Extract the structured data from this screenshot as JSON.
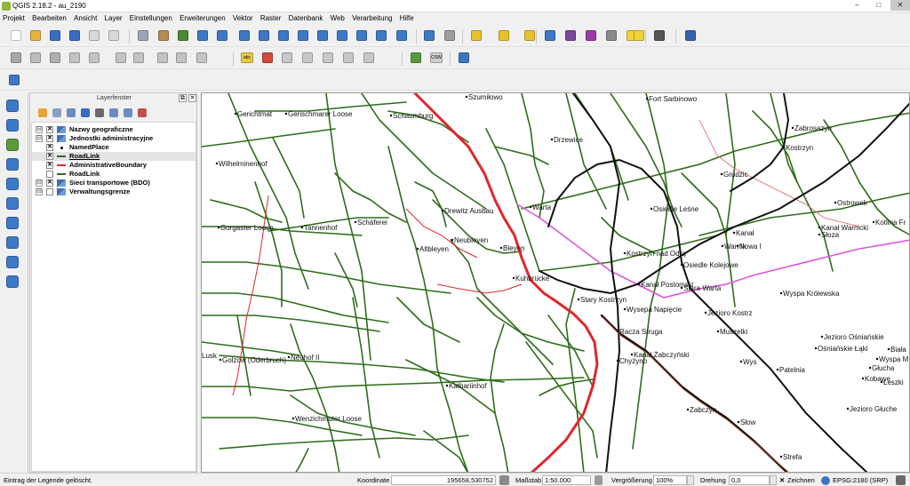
{
  "window": {
    "title": "QGIS 2.18.2 - au_2190",
    "minimize": "–",
    "maximize": "□",
    "close": "✕"
  },
  "menu": [
    "Projekt",
    "Bearbeiten",
    "Ansicht",
    "Layer",
    "Einstellungen",
    "Erweiterungen",
    "Vektor",
    "Raster",
    "Datenbank",
    "Web",
    "Verarbeitung",
    "Hilfe"
  ],
  "toolbar_buttons_row1": [
    {
      "name": "new-project-icon",
      "color": "#ffffff"
    },
    {
      "name": "open-project-icon",
      "color": "#e6b33d"
    },
    {
      "name": "save-project-icon",
      "color": "#3a6cc4"
    },
    {
      "name": "save-as-icon",
      "color": "#3a6cc4"
    },
    {
      "name": "new-print-composer-icon",
      "color": "#d8d8d8"
    },
    {
      "name": "composer-manager-icon",
      "color": "#d8d8d8"
    },
    {
      "name": "touch-zoom-icon",
      "color": "#9aa6b8"
    },
    {
      "name": "pan-icon",
      "color": "#b98a58"
    },
    {
      "name": "pan-to-selection-icon",
      "color": "#4d8a2e"
    },
    {
      "name": "zoom-in-icon",
      "color": "#3d79c7"
    },
    {
      "name": "zoom-out-icon",
      "color": "#3d79c7"
    },
    {
      "name": "zoom-native-icon",
      "color": "#3d79c7"
    },
    {
      "name": "zoom-full-icon",
      "color": "#3d79c7"
    },
    {
      "name": "zoom-selection-icon",
      "color": "#3d79c7"
    },
    {
      "name": "zoom-layer-icon",
      "color": "#3d79c7"
    },
    {
      "name": "zoom-last-icon",
      "color": "#3d79c7"
    },
    {
      "name": "zoom-next-icon",
      "color": "#3d79c7"
    },
    {
      "name": "new-bookmark-icon",
      "color": "#3d79c7"
    },
    {
      "name": "show-bookmarks-icon",
      "color": "#3d79c7"
    },
    {
      "name": "refresh-icon",
      "color": "#3d79c7"
    },
    {
      "name": "identify-icon",
      "color": "#3d79c7"
    },
    {
      "name": "action-icon",
      "color": "#9e9e9e"
    },
    {
      "name": "select-features-icon",
      "color": "#e7c22a"
    },
    {
      "name": "select-by-value-icon",
      "color": "#e7c22a"
    },
    {
      "name": "deselect-icon",
      "color": "#e7c22a"
    },
    {
      "name": "attribute-table-icon",
      "color": "#3d79c7"
    },
    {
      "name": "field-calculator-icon",
      "color": "#7a4a9c"
    },
    {
      "name": "statistics-icon",
      "color": "#9c3aa8"
    },
    {
      "name": "measure-icon",
      "color": "#8a8a8a"
    },
    {
      "name": "map-tips-icon",
      "color": "#f2d335"
    },
    {
      "name": "annotation-icon",
      "color": "#f2d335"
    },
    {
      "name": "text-annotation-icon",
      "color": "#555555"
    },
    {
      "name": "help-icon",
      "color": "#3a5fb0"
    }
  ],
  "toolbar_buttons_row2": [
    {
      "name": "current-edits-icon",
      "color": "#a9a9a9"
    },
    {
      "name": "toggle-editing-icon",
      "color": "#bdbdbd"
    },
    {
      "name": "save-edits-icon",
      "color": "#b0b0b0"
    },
    {
      "name": "add-feature-icon",
      "color": "#c4c4c4"
    },
    {
      "name": "move-feature-icon",
      "color": "#c4c4c4"
    },
    {
      "name": "node-tool-icon",
      "color": "#c4c4c4"
    },
    {
      "name": "delete-selected-icon",
      "color": "#c4c4c4"
    },
    {
      "name": "cut-features-icon",
      "color": "#c4c4c4"
    },
    {
      "name": "copy-features-icon",
      "color": "#c4c4c4"
    },
    {
      "name": "paste-features-icon",
      "color": "#c4c4c4"
    },
    {
      "name": "label-tool-icon",
      "color": "#e8c84a"
    },
    {
      "name": "layer-labeling-icon",
      "color": "#d24a3a"
    },
    {
      "name": "pin-labels-icon",
      "color": "#c8c8c8"
    },
    {
      "name": "show-labels-icon",
      "color": "#c8c8c8"
    },
    {
      "name": "move-label-icon",
      "color": "#c8c8c8"
    },
    {
      "name": "rotate-label-icon",
      "color": "#c8c8c8"
    },
    {
      "name": "change-label-icon",
      "color": "#c8c8c8"
    },
    {
      "name": "metasearch-icon",
      "color": "#5b9a3a"
    },
    {
      "name": "csw-icon",
      "color": "#cfcfcf"
    },
    {
      "name": "python-console-icon",
      "color": "#3a76c4"
    }
  ],
  "toolbar_row2_texts": {
    "abc": "abc",
    "csw": "CSW"
  },
  "toolbar_buttons_row3": [
    {
      "name": "digitize-icon",
      "color": "#3d79c7"
    }
  ],
  "left_toolbar": [
    {
      "name": "add-vector-layer-icon",
      "color": "#3d79c7"
    },
    {
      "name": "add-raster-layer-icon",
      "color": "#3d79c7"
    },
    {
      "name": "add-spatialite-layer-icon",
      "color": "#5b9a3a"
    },
    {
      "name": "add-mssql-layer-icon",
      "color": "#3d79c7"
    },
    {
      "name": "add-wms-layer-icon",
      "color": "#3d79c7"
    },
    {
      "name": "add-wcs-layer-icon",
      "color": "#3d79c7"
    },
    {
      "name": "add-wfs-layer-icon",
      "color": "#3d79c7"
    },
    {
      "name": "add-delimited-text-icon",
      "color": "#3d79c7"
    },
    {
      "name": "new-shapefile-icon",
      "color": "#3d79c7"
    },
    {
      "name": "new-memory-layer-icon",
      "color": "#3d79c7"
    }
  ],
  "layer_panel": {
    "title": "Layerfenster",
    "float_button": "⧉",
    "close_button": "✕",
    "tools": [
      {
        "name": "open-styling-icon",
        "color": "#e8a33a"
      },
      {
        "name": "add-group-icon",
        "color": "#8aa0c0"
      },
      {
        "name": "manage-visibility-icon",
        "color": "#6b8cc0"
      },
      {
        "name": "filter-legend-icon",
        "color": "#3a6cc4"
      },
      {
        "name": "filter-expression-icon",
        "color": "#6b6b6b"
      },
      {
        "name": "expand-all-icon",
        "color": "#6b8cc0"
      },
      {
        "name": "collapse-all-icon",
        "color": "#6b8cc0"
      },
      {
        "name": "remove-layer-icon",
        "color": "#c0504d"
      }
    ],
    "layers": [
      {
        "label": "Nazwy geograficzne",
        "expand": "⊟",
        "check": "✕",
        "legend": "wms",
        "indent": 0,
        "selected": false
      },
      {
        "label": "Jednostki administracyjne",
        "expand": "⊟",
        "check": "✕",
        "legend": "wms",
        "indent": 0,
        "selected": false
      },
      {
        "label": "NamedPlace",
        "expand": "",
        "check": "✕",
        "legend": "point",
        "indent": 1,
        "selected": false
      },
      {
        "label": "RoadLink",
        "expand": "",
        "check": "✕",
        "legend": "green-line",
        "indent": 1,
        "selected": true
      },
      {
        "label": "AdministrativeBoundary",
        "expand": "",
        "check": "✕",
        "legend": "red-line",
        "indent": 1,
        "selected": false
      },
      {
        "label": "RoadLink",
        "expand": "",
        "check": "",
        "legend": "green-line",
        "indent": 1,
        "selected": false
      },
      {
        "label": "Sieci transportowe (BDO)",
        "expand": "⊟",
        "check": "✕",
        "legend": "wms",
        "indent": 0,
        "selected": false
      },
      {
        "label": "Verwaltungsgrenze",
        "expand": "⊟",
        "check": "",
        "legend": "wms",
        "indent": 0,
        "selected": false
      }
    ]
  },
  "map": {
    "background": "#ffffff",
    "road_color": "#2f6d1a",
    "boundary_color": "#e0262b",
    "rail_color": "#111111",
    "magenta_color": "#dd55dd",
    "place_labels": [
      "Szumiłowo",
      "Fort Sarbinowo",
      "Gerichtmat",
      "Gerischmarer Loose",
      "Schaumburg",
      "Drzewice",
      "Zabrosazyn",
      "Kostrzyn",
      "Wilhelminenhof",
      "Grudzic",
      "Ostrowek",
      "Warta",
      "Osiedle Leśne",
      "Drewitz Ausbau",
      "Gorgaster Loose",
      "Tannenhof",
      "Schäferei",
      "Kanał Warnicki",
      "Kotlina Fr",
      "Kanał",
      "Słoza",
      "Warnik",
      "Nowa I",
      "Neubleyen",
      "Altbleyen",
      "Bleyen",
      "Kostrzyn nad Odrą",
      "Osiedle Kolejowe",
      "Kuhbrücke",
      "Kanał Postomski",
      "Stara Warta",
      "Wyspa Królewska",
      "Stary Kostrzyn",
      "Wysepa Napięcie",
      "Jezioro Kostrz",
      "Racza Struga",
      "Muszelki",
      "Jezioro Ośniańskie",
      "Ośniańskie Łąki",
      "Biała",
      "Wyspa M",
      "Głucha",
      "Lusk",
      "Golzow (Oderbruch)",
      "Neuhof II",
      "Kanał Żabczyński",
      "Chyżyno",
      "Wys",
      "Patelnia",
      "Kobawe",
      "Łeszki",
      "Kathariinhof",
      "Jezioro Głuche",
      "Zabczyn",
      "Wenzichmuter Loose",
      "Słow",
      "Strefa"
    ]
  },
  "status": {
    "message": "Eintrag der Legende gelöscht.",
    "coord_label": "Koordinate",
    "coord_value": "195658,530752",
    "scale_label": "Maßstab",
    "scale_value": "1:50.000",
    "magnifier_label": "Vergrößerung",
    "magnifier_value": "100%",
    "rotation_label": "Drehung",
    "rotation_value": "0,0",
    "render_label": "Zeichnen",
    "render_check": "✕",
    "crs": "EPSG:2180 (SRP)"
  }
}
